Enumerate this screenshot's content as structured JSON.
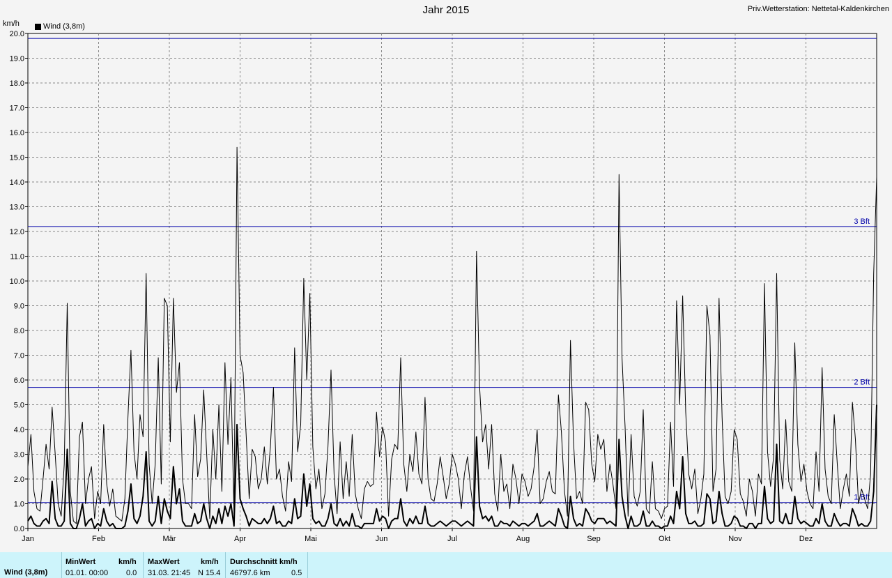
{
  "header": {
    "title": "Jahr 2015",
    "station": "Priv.Wetterstation: Nettetal-Kaldenkirchen",
    "unit": "km/h"
  },
  "legend": {
    "label": "Wind (3,8m)",
    "color": "#000000"
  },
  "chart_data": {
    "type": "line",
    "title": "Jahr 2015",
    "ylabel": "km/h",
    "ylim": [
      0,
      20
    ],
    "yticks": [
      "0.0",
      "1.0",
      "2.0",
      "3.0",
      "4.0",
      "5.0",
      "6.0",
      "7.0",
      "8.0",
      "9.0",
      "10.0",
      "11.0",
      "12.0",
      "13.0",
      "14.0",
      "15.0",
      "16.0",
      "17.0",
      "18.0",
      "19.0",
      "20.0"
    ],
    "xticks": [
      "Jan",
      "Feb",
      "Mär",
      "Apr",
      "Mai",
      "Jun",
      "Jul",
      "Aug",
      "Sep",
      "Okt",
      "Nov",
      "Dez"
    ],
    "grid": true,
    "reference_lines": [
      {
        "label": "1 Bft",
        "value": 1.05,
        "color": "#0000aa"
      },
      {
        "label": "2 Bft",
        "value": 5.7,
        "color": "#0000aa"
      },
      {
        "label": "3 Bft",
        "value": 12.2,
        "color": "#0000aa"
      },
      {
        "label": "",
        "value": 19.8,
        "color": "#0000aa"
      }
    ],
    "series": [
      {
        "name": "Wind (3,8m)",
        "style": "gust",
        "color": "#000000",
        "values": [
          2.5,
          3.8,
          1.5,
          0.8,
          0.7,
          2.0,
          3.4,
          2.4,
          4.9,
          3.0,
          1.0,
          0.5,
          2.6,
          9.1,
          1.5,
          0.3,
          0.2,
          3.7,
          4.3,
          1.0,
          2.0,
          2.5,
          0.4,
          1.5,
          1.0,
          4.2,
          1.8,
          0.9,
          1.6,
          0.5,
          0.4,
          0.3,
          1.2,
          4.5,
          7.2,
          3.1,
          2.0,
          4.6,
          3.7,
          10.3,
          2.6,
          1.0,
          2.6,
          6.9,
          1.8,
          9.3,
          9.0,
          3.5,
          9.3,
          5.5,
          6.7,
          2.0,
          1.0,
          1.0,
          0.8,
          4.6,
          2.1,
          2.8,
          5.6,
          3.0,
          0.4,
          4.0,
          2.0,
          5.0,
          1.5,
          6.7,
          3.4,
          6.1,
          0.6,
          15.4,
          7.0,
          6.3,
          3.8,
          1.2,
          3.2,
          2.9,
          1.6,
          2.0,
          3.3,
          1.8,
          3.3,
          5.7,
          2.0,
          2.4,
          1.3,
          0.7,
          2.7,
          1.9,
          7.3,
          3.1,
          4.2,
          10.1,
          6.0,
          9.5,
          3.3,
          1.6,
          2.4,
          0.8,
          1.4,
          3.3,
          6.4,
          2.2,
          0.6,
          3.5,
          1.2,
          2.7,
          1.3,
          3.8,
          1.4,
          0.8,
          0.4,
          1.6,
          1.9,
          1.7,
          1.8,
          4.7,
          2.9,
          4.1,
          3.5,
          0.5,
          2.8,
          3.4,
          3.2,
          6.9,
          2.6,
          1.5,
          3.0,
          2.3,
          3.9,
          2.2,
          1.8,
          5.3,
          2.0,
          1.2,
          1.1,
          1.8,
          2.9,
          2.1,
          1.2,
          1.8,
          3.0,
          2.6,
          2.0,
          0.8,
          2.2,
          2.9,
          1.7,
          0.7,
          11.2,
          5.8,
          3.5,
          4.2,
          2.4,
          4.2,
          1.4,
          0.7,
          3.0,
          1.5,
          1.8,
          0.8,
          2.6,
          2.0,
          1.0,
          2.2,
          1.9,
          1.3,
          1.6,
          2.5,
          4.0,
          1.0,
          1.2,
          1.9,
          2.3,
          1.5,
          1.4,
          5.4,
          3.9,
          1.5,
          0.5,
          7.6,
          3.5,
          1.2,
          1.5,
          1.0,
          5.1,
          4.8,
          2.6,
          1.9,
          3.8,
          3.2,
          3.6,
          1.5,
          2.6,
          1.8,
          0.8,
          14.3,
          6.9,
          4.1,
          0.5,
          3.8,
          1.3,
          0.9,
          1.5,
          4.8,
          0.8,
          0.6,
          2.7,
          0.8,
          0.7,
          0.4,
          0.8,
          0.9,
          4.3,
          1.7,
          9.2,
          5.0,
          9.4,
          4.7,
          2.2,
          1.6,
          2.4,
          0.6,
          1.2,
          2.2,
          9.0,
          7.8,
          1.5,
          2.4,
          9.3,
          4.5,
          1.3,
          1.0,
          1.5,
          4.0,
          3.6,
          1.4,
          1.1,
          0.5,
          2.0,
          1.5,
          0.5,
          2.2,
          1.8,
          9.9,
          3.1,
          1.7,
          2.9,
          10.3,
          2.8,
          1.6,
          4.4,
          1.9,
          1.5,
          7.5,
          3.4,
          1.9,
          2.6,
          1.5,
          1.0,
          0.8,
          3.1,
          1.5,
          6.5,
          2.4,
          1.3,
          1.0,
          4.6,
          2.6,
          0.8,
          1.6,
          2.2,
          1.3,
          5.1,
          3.6,
          1.0,
          1.6,
          1.2,
          0.8,
          2.2,
          10.3,
          14.2
        ]
      },
      {
        "name": "",
        "style": "mean",
        "color": "#000000",
        "values": [
          0.3,
          0.5,
          0.2,
          0.1,
          0.1,
          0.3,
          0.4,
          0.2,
          1.9,
          0.4,
          0.1,
          0.1,
          0.3,
          3.2,
          0.2,
          0.0,
          0.0,
          0.4,
          1.0,
          0.1,
          0.3,
          0.4,
          0.0,
          0.2,
          0.1,
          0.8,
          0.3,
          0.1,
          0.2,
          0.0,
          0.0,
          0.0,
          0.1,
          0.7,
          1.8,
          0.4,
          0.2,
          0.5,
          1.3,
          3.1,
          0.3,
          0.1,
          0.3,
          1.3,
          0.2,
          1.2,
          0.7,
          0.4,
          2.5,
          1.0,
          1.6,
          0.3,
          0.1,
          0.1,
          0.1,
          0.6,
          0.2,
          0.3,
          1.0,
          0.4,
          0.0,
          0.5,
          0.2,
          0.8,
          0.2,
          0.9,
          0.5,
          1.0,
          0.1,
          4.2,
          1.2,
          0.8,
          0.5,
          0.1,
          0.4,
          0.3,
          0.2,
          0.2,
          0.4,
          0.2,
          0.4,
          0.9,
          0.2,
          0.3,
          0.1,
          0.1,
          0.3,
          0.2,
          1.2,
          0.4,
          0.5,
          2.2,
          0.9,
          1.8,
          0.4,
          0.2,
          0.3,
          0.1,
          0.1,
          0.4,
          1.0,
          0.2,
          0.1,
          0.4,
          0.1,
          0.3,
          0.1,
          0.6,
          0.1,
          0.1,
          0.0,
          0.2,
          0.2,
          0.2,
          0.2,
          0.8,
          0.3,
          0.5,
          0.4,
          0.0,
          0.3,
          0.4,
          0.4,
          1.2,
          0.3,
          0.1,
          0.4,
          0.2,
          0.5,
          0.2,
          0.2,
          0.9,
          0.2,
          0.1,
          0.1,
          0.2,
          0.3,
          0.2,
          0.1,
          0.2,
          0.3,
          0.3,
          0.2,
          0.1,
          0.2,
          0.3,
          0.2,
          0.1,
          3.7,
          0.9,
          0.4,
          0.5,
          0.3,
          0.5,
          0.1,
          0.1,
          0.3,
          0.2,
          0.2,
          0.1,
          0.3,
          0.2,
          0.1,
          0.2,
          0.2,
          0.1,
          0.2,
          0.3,
          0.6,
          0.1,
          0.1,
          0.2,
          0.3,
          0.2,
          0.1,
          0.8,
          0.5,
          0.1,
          0.0,
          1.3,
          0.4,
          0.1,
          0.2,
          0.1,
          0.8,
          0.6,
          0.3,
          0.2,
          0.4,
          0.4,
          0.4,
          0.2,
          0.3,
          0.2,
          0.1,
          3.6,
          1.3,
          0.5,
          0.0,
          0.5,
          0.1,
          0.1,
          0.2,
          0.7,
          0.1,
          0.1,
          0.3,
          0.1,
          0.1,
          0.0,
          0.1,
          0.1,
          0.5,
          0.2,
          1.5,
          0.8,
          2.9,
          0.6,
          0.2,
          0.2,
          0.3,
          0.1,
          0.1,
          0.2,
          1.4,
          1.2,
          0.2,
          0.3,
          1.5,
          0.6,
          0.1,
          0.1,
          0.2,
          0.5,
          0.4,
          0.1,
          0.1,
          0.0,
          0.2,
          0.2,
          0.0,
          0.2,
          0.2,
          1.7,
          0.4,
          0.2,
          0.3,
          3.4,
          0.3,
          0.2,
          0.6,
          0.2,
          0.2,
          1.3,
          0.4,
          0.2,
          0.3,
          0.2,
          0.1,
          0.1,
          0.4,
          0.2,
          1.0,
          0.3,
          0.1,
          0.1,
          0.6,
          0.3,
          0.1,
          0.2,
          0.2,
          0.1,
          0.8,
          0.5,
          0.1,
          0.2,
          0.1,
          0.1,
          0.3,
          1.5,
          5.0
        ]
      }
    ]
  },
  "stats": {
    "series_label": "Wind (3,8m)",
    "min": {
      "header": "MinWert",
      "unit": "km/h",
      "date": "01.01.  00:00",
      "value": "0.0"
    },
    "max": {
      "header": "MaxWert",
      "unit": "km/h",
      "date": "31.03.  21:45",
      "value": "N 15.4"
    },
    "avg": {
      "header": "Durchschnitt km/h",
      "distance": "46797.6 km",
      "value": "0.5"
    }
  }
}
